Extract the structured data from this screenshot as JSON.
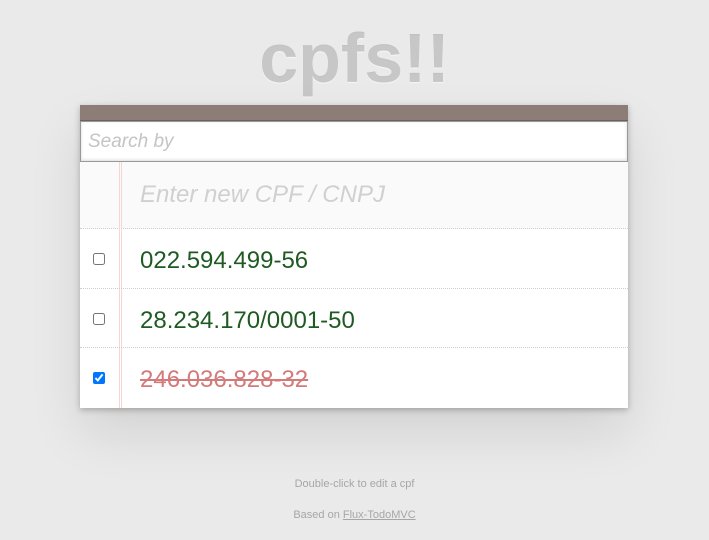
{
  "app": {
    "title": "cpfs!!"
  },
  "search": {
    "placeholder": "Search by",
    "value": ""
  },
  "new_entry": {
    "placeholder": "Enter new CPF / CNPJ",
    "value": ""
  },
  "items": [
    {
      "label": "022.594.499-56",
      "completed": false
    },
    {
      "label": "28.234.170/0001-50",
      "completed": false
    },
    {
      "label": "246.036.828-32",
      "completed": true
    }
  ],
  "footer": {
    "hint": "Double-click to edit a cpf",
    "credit_prefix": "Based on",
    "credit_link": "Flux-TodoMVC"
  },
  "colors": {
    "header_bar": "#8d7d77",
    "active_text": "#1f5a22",
    "completed_text": "#d37a7a"
  }
}
